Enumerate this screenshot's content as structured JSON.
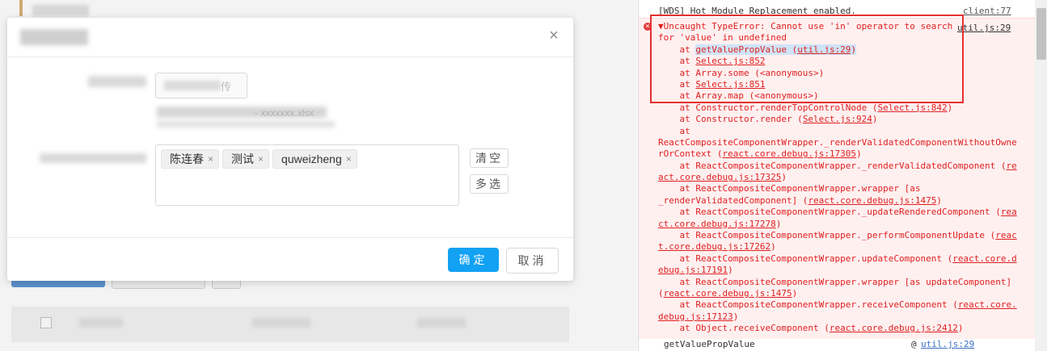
{
  "modal": {
    "close_glyph": "×",
    "upload_text": "传",
    "hint_text": "- xxxxxxx.xlsx",
    "tags": [
      {
        "label": "陈连春",
        "remove": "×"
      },
      {
        "label": "测试",
        "remove": "×"
      },
      {
        "label": "quweizheng",
        "remove": "×"
      }
    ],
    "clear_label": "清空",
    "multi_label": "多选",
    "ok_label": "确定",
    "cancel_label": "取消"
  },
  "console": {
    "wds": {
      "text": "[WDS] Hot Module Replacement enabled.",
      "source": "client:77"
    },
    "error": {
      "icon": "×",
      "source": "util.js:29",
      "message_1": "▼Uncaught TypeError: Cannot use 'in' operator to search",
      "message_2": "for 'value' in undefined",
      "stack": [
        {
          "pre": "    at ",
          "fn": "getValuePropValue (",
          "link": "util.js:29",
          "post": ")"
        },
        {
          "pre": "    at ",
          "fn": "",
          "link": "Select.js:852",
          "post": ""
        },
        {
          "pre": "    at Array.some (<anonymous>)",
          "fn": "",
          "link": "",
          "post": ""
        },
        {
          "pre": "    at ",
          "fn": "",
          "link": "Select.js:851",
          "post": ""
        },
        {
          "pre": "    at Array.map (<anonymous>)",
          "fn": "",
          "link": "",
          "post": ""
        },
        {
          "pre": "    at Constructor.renderTopControlNode (",
          "fn": "",
          "link": "Select.js:842",
          "post": ")"
        },
        {
          "pre": "    at Constructor.render (",
          "fn": "",
          "link": "Select.js:924",
          "post": ")"
        },
        {
          "pre": "    at",
          "fn": "",
          "link": "",
          "post": ""
        },
        {
          "pre": "ReactCompositeComponentWrapper._renderValidatedComponentWithoutOwne",
          "fn": "",
          "link": "",
          "post": ""
        },
        {
          "pre": "rOrContext (",
          "fn": "",
          "link": "react.core.debug.js:17305",
          "post": ")"
        },
        {
          "pre": "    at ReactCompositeComponentWrapper._renderValidatedComponent (",
          "fn": "",
          "link": "re",
          "post": ""
        },
        {
          "pre": "",
          "fn": "",
          "link": "act.core.debug.js:17325",
          "post": ")"
        },
        {
          "pre": "    at ReactCompositeComponentWrapper.wrapper [as",
          "fn": "",
          "link": "",
          "post": ""
        },
        {
          "pre": "_renderValidatedComponent] (",
          "fn": "",
          "link": "react.core.debug.js:1475",
          "post": ")"
        },
        {
          "pre": "    at ReactCompositeComponentWrapper._updateRenderedComponent (",
          "fn": "",
          "link": "rea",
          "post": ""
        },
        {
          "pre": "",
          "fn": "",
          "link": "ct.core.debug.js:17278",
          "post": ")"
        },
        {
          "pre": "    at ReactCompositeComponentWrapper._performComponentUpdate (",
          "fn": "",
          "link": "reac",
          "post": ""
        },
        {
          "pre": "",
          "fn": "",
          "link": "t.core.debug.js:17262",
          "post": ")"
        },
        {
          "pre": "    at ReactCompositeComponentWrapper.updateComponent (",
          "fn": "",
          "link": "react.core.d",
          "post": ""
        },
        {
          "pre": "",
          "fn": "",
          "link": "ebug.js:17191",
          "post": ")"
        },
        {
          "pre": "    at ReactCompositeComponentWrapper.wrapper [as updateComponent]",
          "fn": "",
          "link": "",
          "post": ""
        },
        {
          "pre": "(",
          "fn": "",
          "link": "react.core.debug.js:1475",
          "post": ")"
        },
        {
          "pre": "    at ReactCompositeComponentWrapper.receiveComponent (",
          "fn": "",
          "link": "react.core.",
          "post": ""
        },
        {
          "pre": "",
          "fn": "",
          "link": "debug.js:17123",
          "post": ")"
        },
        {
          "pre": "    at Object.receiveComponent (",
          "fn": "",
          "link": "react.core.debug.js:2412",
          "post": ")"
        }
      ]
    },
    "footer": {
      "fn": "getValuePropValue",
      "at": "@",
      "source": "util.js:29"
    }
  }
}
